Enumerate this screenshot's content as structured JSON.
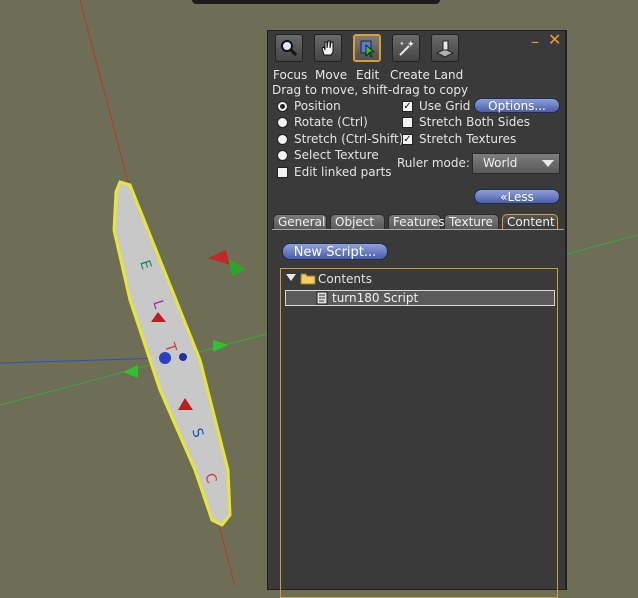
{
  "panel": {
    "title_buttons": {
      "minimize": "–",
      "close": "✕"
    },
    "tools": [
      {
        "label": "Focus",
        "icon": "magnifier-icon"
      },
      {
        "label": "Move",
        "icon": "hand-icon"
      },
      {
        "label": "Edit",
        "icon": "cursor-icon"
      },
      {
        "label": "Create",
        "icon": "magic-wand-icon"
      },
      {
        "label": "Land",
        "icon": "land-icon"
      }
    ],
    "hint": "Drag to move, shift-drag to copy",
    "modes": [
      {
        "label": "Position",
        "selected": true
      },
      {
        "label": "Rotate (Ctrl)",
        "selected": false
      },
      {
        "label": "Stretch (Ctrl-Shift)",
        "selected": false
      },
      {
        "label": "Select Texture",
        "selected": false
      }
    ],
    "edit_linked": {
      "label": "Edit linked parts",
      "checked": false
    },
    "options": [
      {
        "label": "Use Grid",
        "checked": true
      },
      {
        "label": "Stretch Both Sides",
        "checked": false
      },
      {
        "label": "Stretch Textures",
        "checked": true
      }
    ],
    "options_button": "Options...",
    "ruler_mode_label": "Ruler mode:",
    "ruler_mode_value": "World",
    "less_button": "«Less",
    "tabs": [
      "General",
      "Object",
      "Features",
      "Texture",
      "Content"
    ],
    "active_tab": "Content",
    "new_script_button": "New Script...",
    "contents": {
      "folder": "Contents",
      "items": [
        "turn180 Script"
      ]
    }
  },
  "colors": {
    "accent": "#d8a030",
    "button_blue": "#5a6cb4",
    "panel_bg": "#3a3a3a"
  }
}
